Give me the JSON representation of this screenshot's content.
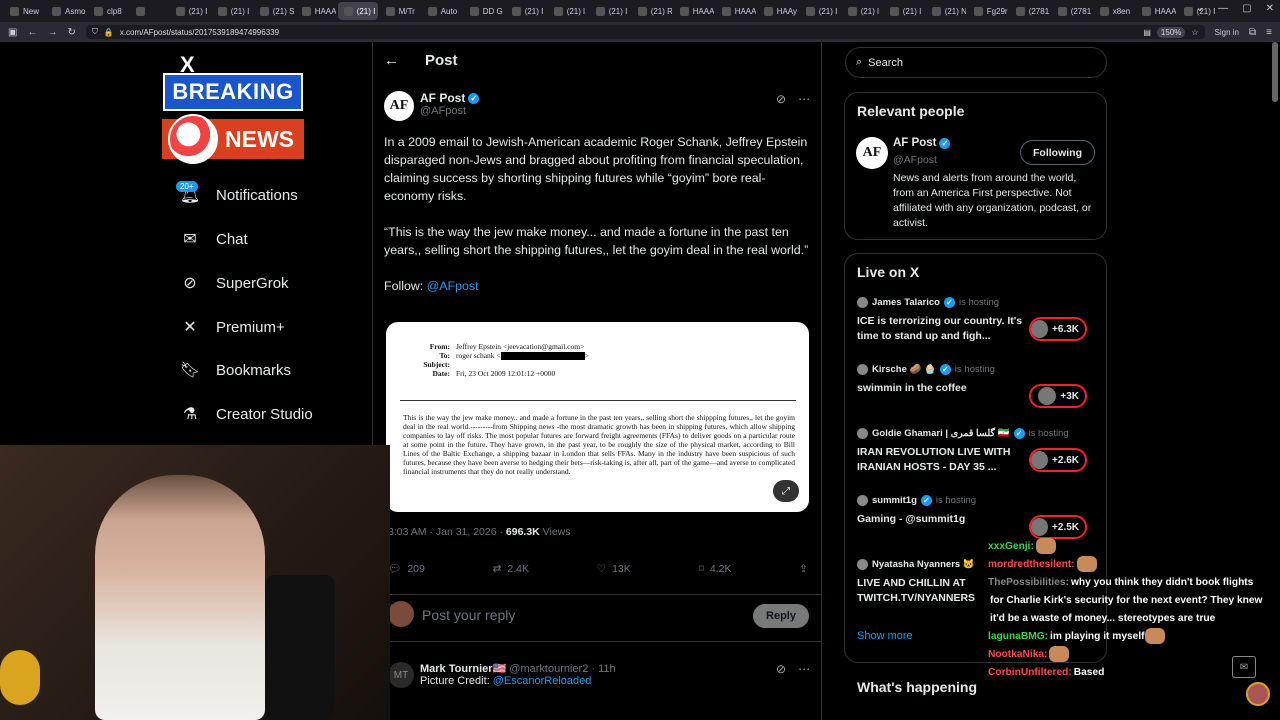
{
  "browser": {
    "tabs": [
      "New",
      "Asmon",
      "clp8",
      "",
      "(21) I",
      "(21) I",
      "(21) S",
      "HAAA",
      "(21) I",
      "M/Tr",
      "Auto",
      "DD G",
      "(21) I",
      "(21) l",
      "(21) I",
      "(21) R",
      "HAAA",
      "HAAA",
      "HAAy",
      "(21) I",
      "(21) l",
      "(21) I",
      "(21) N",
      "Fg29r",
      "(2781",
      "(2781",
      "x8en",
      "HAAA",
      "(21) I"
    ],
    "active_tab_index": 8,
    "url": "x.com/AFpost/status/2017539189474996339",
    "zoom": "150%",
    "signin": "Sign in"
  },
  "left_nav": {
    "x_logo": "X",
    "banner_top": "BREAKING",
    "banner_bottom": "NEWS",
    "notif_badge": "20+",
    "items": [
      {
        "label": "Notifications",
        "icon": "bell-icon"
      },
      {
        "label": "Chat",
        "icon": "mail-icon"
      },
      {
        "label": "SuperGrok",
        "icon": "grok-icon"
      },
      {
        "label": "Premium+",
        "icon": "x-icon"
      },
      {
        "label": "Bookmarks",
        "icon": "bookmark-icon"
      },
      {
        "label": "Creator Studio",
        "icon": "flask-icon"
      }
    ]
  },
  "post": {
    "header": "Post",
    "author_name": "AF Post",
    "author_handle": "@AFpost",
    "avatar_text": "AF",
    "para1": "In a 2009 email to Jewish-American academic Roger Schank, Jeffrey Epstein disparaged non-Jews and bragged about profiting from financial speculation, claiming success by shorting shipping futures while “goyim” bore real-economy risks.",
    "para2": "“This is the way the jew make money... and made a fortune in the past ten years,,  selling short the shipping futures,, let the goyim deal in the real world.”",
    "follow_label": "Follow:",
    "follow_link": "@AFpost",
    "doc": {
      "from_label": "From:",
      "from_value": "Jeffrey Epstein <jeevacation@gmail.com>",
      "to_label": "To:",
      "to_value": "roger schank <",
      "to_end": ">",
      "subject_label": "Subject:",
      "date_label": "Date:",
      "date_value": "Fri, 23 Oct 2009 12:01:12 +0000",
      "text": "This is the way the jew make money..  and made a fortune in the past ten years,,  selling short the shippping futures,, let the goyim deal in the real world.---------from Shipping news -the most dramatic growth has been in shipping futures, which allow shipping companies to lay off risks. The most popular futures are forward freight agreements (FFAs) to deliver goods on a particular route at some point in the future. They have grown, in the past year, to be roughly the size of the physical market, according to Bill Lines of the Baltic Exchange, a shipping bazaar in London that sells FFAs. Many in the industry have been suspicious of such futures, because they have been averse to hedging their bets—risk-taking is, after all, part of the game—and averse to complicated financial instruments that they do not really understand."
    },
    "time": "3:03 AM · Jan 31, 2026 · ",
    "views_count": "696.3K",
    "views_label": " Views",
    "replies": "209",
    "reposts": "2.4K",
    "likes": "13K",
    "bookmarks": "4.2K",
    "reply_placeholder": "Post your reply",
    "reply_button": "Reply",
    "reply2": {
      "name": "Mark Tournier🇺🇸",
      "handle": "@marktournier2 · 11h",
      "text_prefix": "Picture Credit: ",
      "text_link": "@EscanorReloaded"
    }
  },
  "right": {
    "search_placeholder": "Search",
    "relevant_title": "Relevant people",
    "rp_name": "AF Post",
    "rp_handle": "@AFpost",
    "rp_button": "Following",
    "rp_bio": "News and alerts from around the world, from an America First perspective. Not affiliated with any organization, podcast, or activist.",
    "live_title": "Live on X",
    "is_hosting": "is hosting",
    "live": [
      {
        "host": "James Talarico",
        "title": "ICE is terrorizing our country. It's time to stand up and figh...",
        "count": "+6.3K"
      },
      {
        "host": "Kirsche 🥔 🧁",
        "title": "swimmin in the coffee",
        "count": "+3K"
      },
      {
        "host": "Goldie Ghamari | گلسا قمری 🇮🇷",
        "title": "IRAN REVOLUTION LIVE WITH IRANIAN HOSTS - DAY 35 ...",
        "count": "+2.6K"
      },
      {
        "host": "summit1g",
        "title": "Gaming - @summit1g",
        "count": "+2.5K"
      },
      {
        "host": "Nyatasha Nyanners 🐱",
        "title": "LIVE AND CHILLIN AT TWITCH.TV/NYANNERS",
        "count": ""
      }
    ],
    "show_more": "Show more",
    "what_happening": "What's happening"
  },
  "chat": [
    {
      "user": "xxxGenji:",
      "color": "#39d353",
      "msg": "",
      "emote": true
    },
    {
      "user": "mordredthesilent:",
      "color": "#ff4b4b",
      "msg": "",
      "emote": true
    },
    {
      "user": "ThePossibilities:",
      "color": "#888888",
      "msg": "why you think they didn't book flights"
    },
    {
      "user": "",
      "color": "#ffffff",
      "msg": "for Charlie Kirk's security for the next event? They knew"
    },
    {
      "user": "",
      "color": "#ffffff",
      "msg": "it'd be a waste of money... stereotypes are true"
    },
    {
      "user": "lagunaBMG:",
      "color": "#39d353",
      "msg": "im playing it myself",
      "emote": true
    },
    {
      "user": "NootkaNika:",
      "color": "#ff4b4b",
      "msg": "",
      "emote": true
    },
    {
      "user": "CorbinUnfiltered:",
      "color": "#ff4b4b",
      "msg": "Based"
    }
  ]
}
